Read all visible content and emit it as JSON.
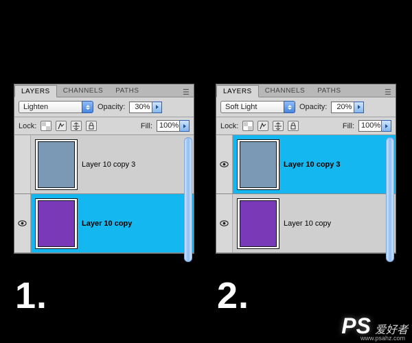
{
  "tabs": {
    "layers": "LAYERS",
    "channels": "CHANNELS",
    "paths": "PATHS"
  },
  "panels": [
    {
      "blend_mode": "Lighten",
      "opacity_label": "Opacity:",
      "opacity_value": "30%",
      "lock_label": "Lock:",
      "fill_label": "Fill:",
      "fill_value": "100%",
      "layers": [
        {
          "name": "Layer 10 copy 3",
          "color": "#7b98b5",
          "selected": false,
          "visible": false
        },
        {
          "name": "Layer 10 copy",
          "color": "#7a39b7",
          "selected": true,
          "visible": true
        }
      ],
      "number_label": "1."
    },
    {
      "blend_mode": "Soft Light",
      "opacity_label": "Opacity:",
      "opacity_value": "20%",
      "lock_label": "Lock:",
      "fill_label": "Fill:",
      "fill_value": "100%",
      "layers": [
        {
          "name": "Layer 10 copy 3",
          "color": "#7b98b5",
          "selected": true,
          "visible": true
        },
        {
          "name": "Layer 10 copy",
          "color": "#7a39b7",
          "selected": false,
          "visible": true
        }
      ],
      "number_label": "2."
    }
  ],
  "watermark": {
    "logo": "PS",
    "sub": "爱好者",
    "url": "www.psahz.com"
  }
}
